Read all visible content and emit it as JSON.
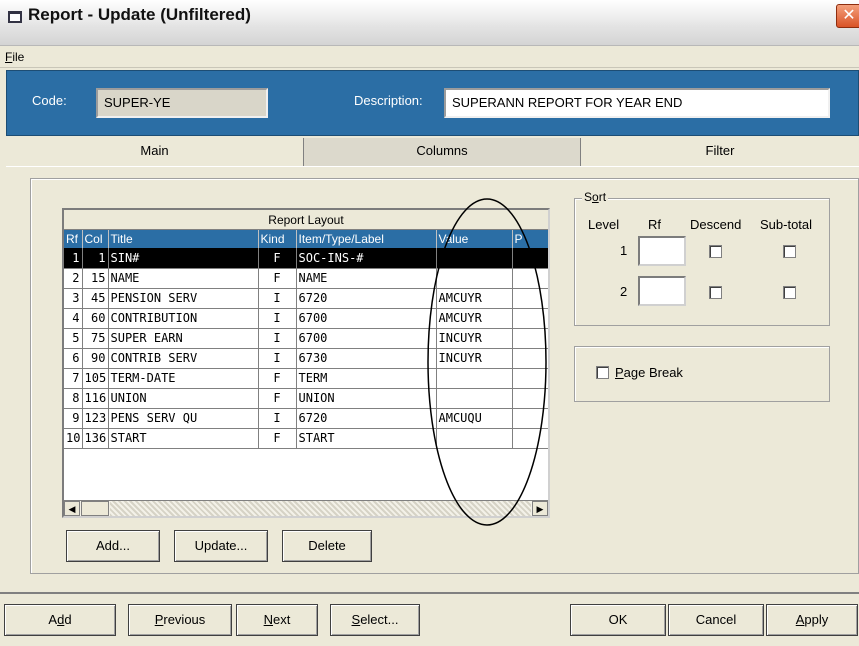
{
  "window": {
    "title": "Report - Update (Unfiltered)",
    "close_glyph": "✕"
  },
  "menu": {
    "file_hotkey": "F",
    "file_rest": "ile"
  },
  "header": {
    "code_label": "Code:",
    "code_value": "SUPER-YE",
    "description_label": "Description:",
    "description_value": "SUPERANN REPORT FOR YEAR END"
  },
  "tabs": [
    {
      "label": "Main",
      "active": false
    },
    {
      "label": "Columns",
      "active": true
    },
    {
      "label": "Filter",
      "active": false
    }
  ],
  "report_layout": {
    "title": "Report Layout",
    "columns": [
      "Rf",
      "Col",
      "Title",
      "Kind",
      "Item/Type/Label",
      "Value",
      "P"
    ],
    "rows": [
      {
        "rf": "1",
        "col": "1",
        "title": "SIN#",
        "kind": "F",
        "item": "SOC-INS-#",
        "value": "",
        "p": "",
        "selected": true
      },
      {
        "rf": "2",
        "col": "15",
        "title": "NAME",
        "kind": "F",
        "item": "NAME",
        "value": "",
        "p": ""
      },
      {
        "rf": "3",
        "col": "45",
        "title": "PENSION SERV",
        "kind": "I",
        "item": "6720",
        "value": "AMCUYR",
        "p": ""
      },
      {
        "rf": "4",
        "col": "60",
        "title": "CONTRIBUTION",
        "kind": "I",
        "item": "6700",
        "value": "AMCUYR",
        "p": ""
      },
      {
        "rf": "5",
        "col": "75",
        "title": "SUPER EARN",
        "kind": "I",
        "item": "6700",
        "value": "INCUYR",
        "p": ""
      },
      {
        "rf": "6",
        "col": "90",
        "title": "CONTRIB SERV",
        "kind": "I",
        "item": "6730",
        "value": "INCUYR",
        "p": ""
      },
      {
        "rf": "7",
        "col": "105",
        "title": "TERM-DATE",
        "kind": "F",
        "item": "TERM",
        "value": "",
        "p": ""
      },
      {
        "rf": "8",
        "col": "116",
        "title": "UNION",
        "kind": "F",
        "item": "UNION",
        "value": "",
        "p": ""
      },
      {
        "rf": "9",
        "col": "123",
        "title": "PENS SERV QU",
        "kind": "I",
        "item": "6720",
        "value": "AMCUQU",
        "p": ""
      },
      {
        "rf": "10",
        "col": "136",
        "title": "START",
        "kind": "F",
        "item": "START",
        "value": "",
        "p": ""
      }
    ],
    "scroll_left_glyph": "◀",
    "scroll_right_glyph": "▶"
  },
  "grid_buttons": {
    "add": "Add...",
    "update": "Update...",
    "delete": "Delete"
  },
  "sort": {
    "legend_pre": "S",
    "legend_hotkey": "o",
    "legend_post": "rt",
    "level_header": "Level",
    "rf_header": "Rf",
    "descend_header": "Descend",
    "subtotal_header": "Sub-total",
    "levels": [
      "1",
      "2"
    ]
  },
  "page_break": {
    "hotkey": "P",
    "rest": "age Break",
    "checked": false
  },
  "footer": {
    "add_pre": "A",
    "add_hotkey": "d",
    "add_post": "d",
    "previous_hotkey": "P",
    "previous_rest": "revious",
    "next_hotkey": "N",
    "next_rest": "ext",
    "select_hotkey": "S",
    "select_rest": "elect...",
    "ok": "OK",
    "cancel": "Cancel",
    "apply_hotkey": "A",
    "apply_rest": "pply"
  },
  "colors": {
    "header_blue": "#2b6ea5",
    "window_face": "#ece9d8",
    "close_red": "#d95327"
  }
}
